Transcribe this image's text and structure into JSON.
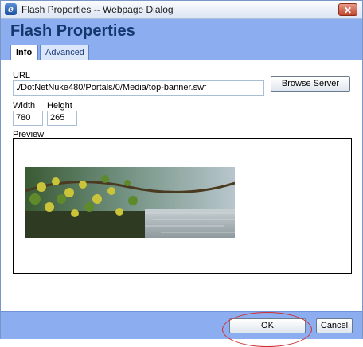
{
  "window": {
    "title": "Flash Properties -- Webpage Dialog",
    "close_label": "✕"
  },
  "dialog": {
    "title": "Flash Properties",
    "tabs": [
      {
        "label": "Info",
        "active": true
      },
      {
        "label": "Advanced",
        "active": false
      }
    ]
  },
  "form": {
    "url_label": "URL",
    "url_value": "./DotNetNuke480/Portals/0/Media/top-banner.swf",
    "browse_label": "Browse Server",
    "width_label": "Width",
    "width_value": "780",
    "height_label": "Height",
    "height_value": "265",
    "preview_label": "Preview"
  },
  "footer": {
    "ok_label": "OK",
    "cancel_label": "Cancel"
  },
  "colors": {
    "header_bg": "#8caef0",
    "title_color": "#16366e",
    "highlight": "#d23030"
  }
}
